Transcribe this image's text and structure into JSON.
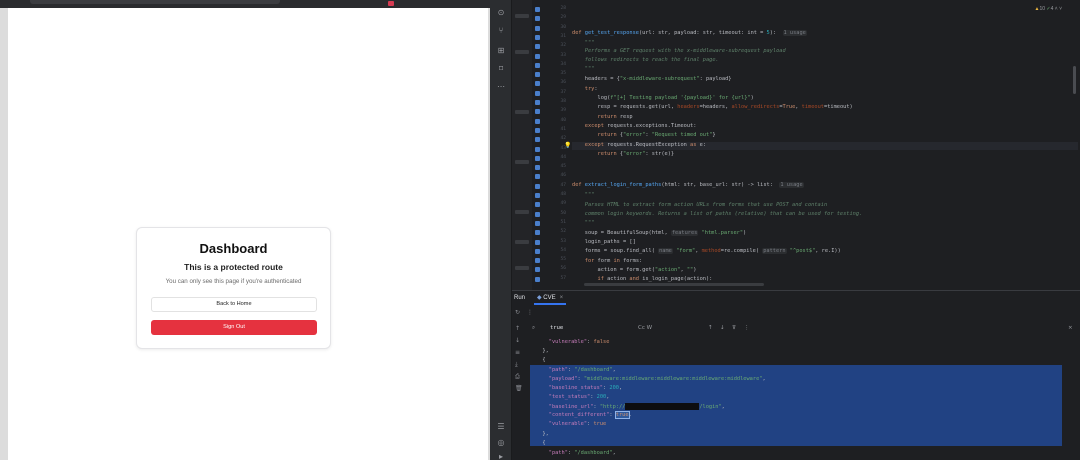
{
  "browser": {
    "card": {
      "title": "Dashboard",
      "subtitle": "This is a protected route",
      "note": "You can only see this page if you're authenticated",
      "back_button": "Back to Home",
      "signout_button": "Sign Out"
    }
  },
  "ide": {
    "inspections": {
      "warnings": "10",
      "checks": "4"
    },
    "run_panel": {
      "run_label": "Run",
      "tab_label": "CVE",
      "search_query": "true",
      "search_options": "Cc  W"
    },
    "colors": {
      "selection": "#214283",
      "signout": "#e5323f",
      "accent": "#3574f0"
    }
  }
}
